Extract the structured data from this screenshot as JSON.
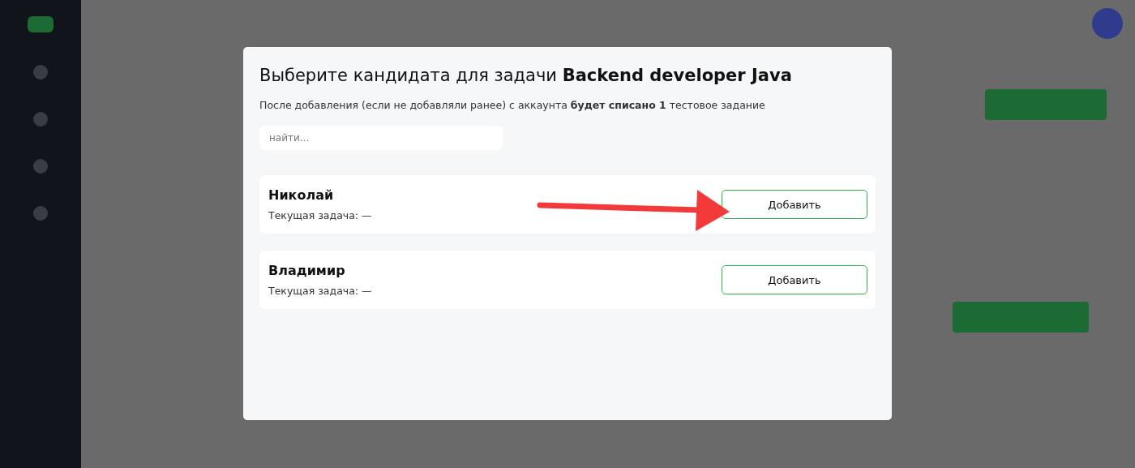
{
  "modal": {
    "title": "Выберите кандидата для задачи **Backend developer Java**",
    "note": "После добавления (если не добавляли ранее) с аккаунта **будет списано 1** тестовое задание",
    "search": {
      "placeholder": "найти..."
    },
    "candidates": [
      {
        "name": "Николай",
        "task_label": "Текущая задача: —",
        "button": "Добавить"
      },
      {
        "name": "Владимир",
        "task_label": "Текущая задача: —",
        "button": "Добавить"
      }
    ]
  }
}
